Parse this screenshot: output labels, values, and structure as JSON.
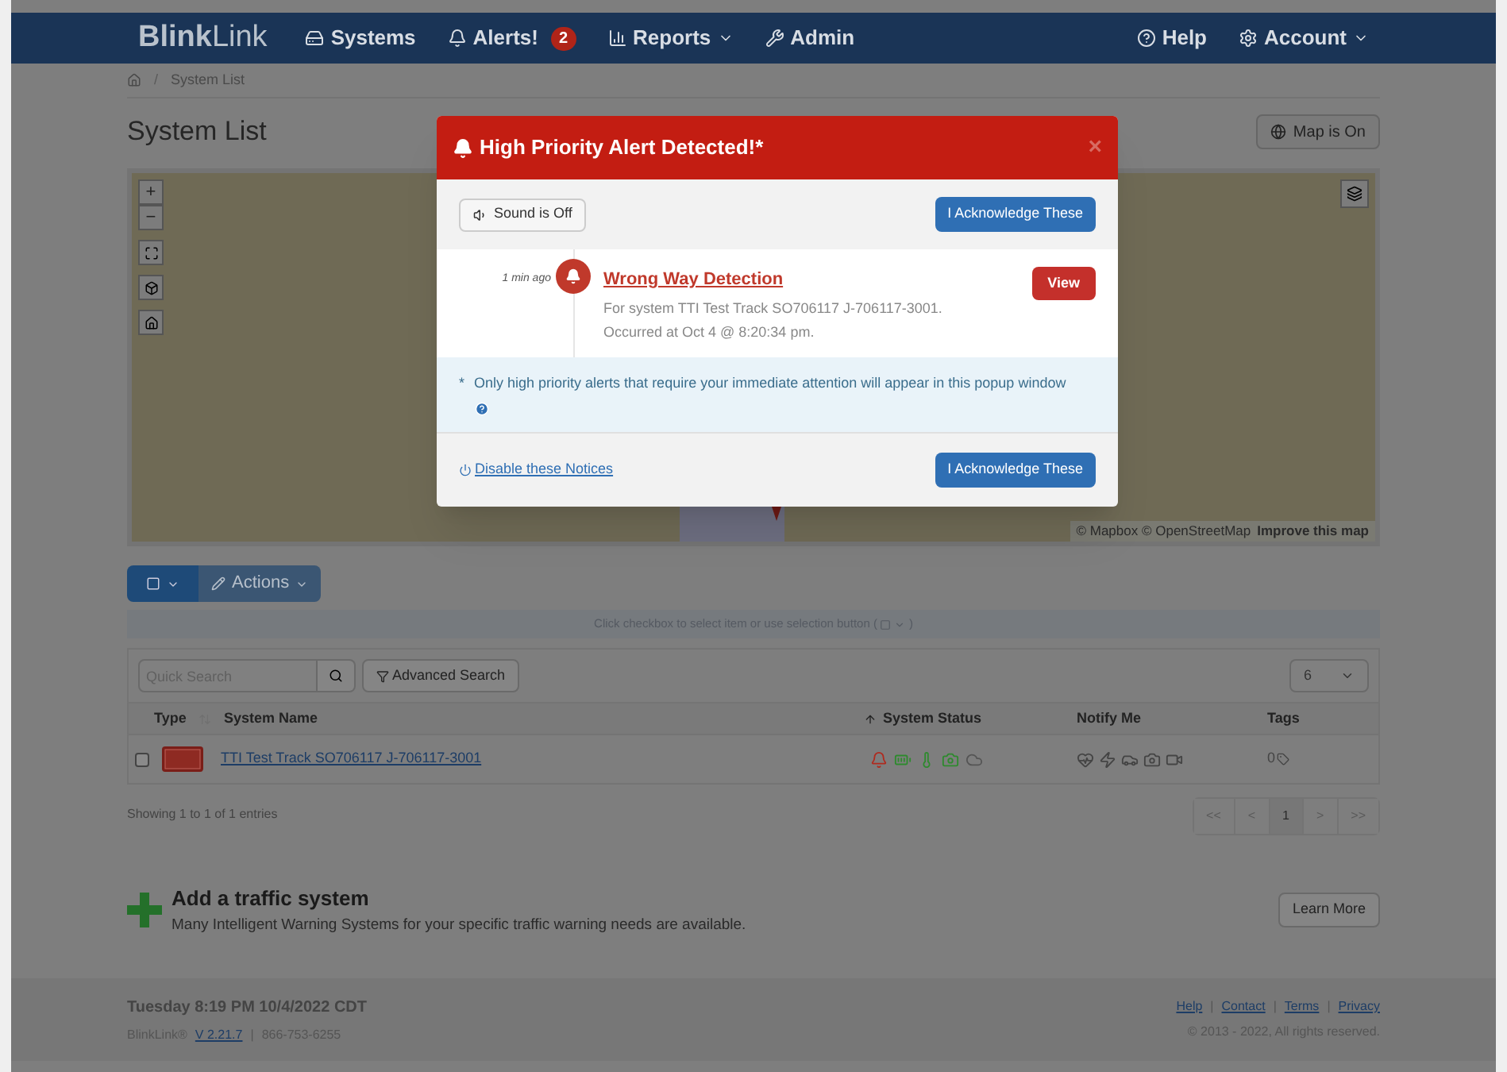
{
  "navbar": {
    "brand": "**Blink**Link",
    "items": [
      {
        "kind": "systems",
        "label": "Systems",
        "dropdown": false
      },
      {
        "kind": "alerts",
        "label": "Alerts!",
        "badge": "2",
        "dropdown": false
      },
      {
        "kind": "reports",
        "label": "Reports",
        "dropdown": true
      },
      {
        "kind": "admin",
        "label": "Admin",
        "dropdown": false
      }
    ],
    "right_items": [
      {
        "kind": "help",
        "label": "Help",
        "dropdown": false
      },
      {
        "kind": "account",
        "label": "Account",
        "dropdown": true
      }
    ]
  },
  "breadcrumb": [
    {
      "separator": "/",
      "label": "System List"
    }
  ],
  "page_title": "System List",
  "map_toggle": "Map is On",
  "map": {
    "zoom_in": "+",
    "zoom_out": "−",
    "attribution": "© Mapbox © OpenStreetMap",
    "improve_link": "Improve this map"
  },
  "toolbar": {
    "actions": "Actions",
    "hint": "Click checkbox to select item or use selection button (",
    "hint_end": ")"
  },
  "search": {
    "placeholder": "Quick Search",
    "advanced": "Advanced Search",
    "page_size": "6"
  },
  "table": {
    "columns": [
      {
        "label": "Type",
        "sortable_hint": false,
        "sorted": false
      },
      {
        "label": "System Name",
        "sortable_hint": true,
        "sorted": false
      },
      {
        "label": "System Status",
        "sortable_hint": false,
        "sorted": true
      },
      {
        "label": "Notify Me",
        "sortable_hint": false,
        "sorted": false
      },
      {
        "label": "Tags",
        "sortable_hint": false,
        "sorted": false
      }
    ],
    "rows": [
      {
        "checked": false,
        "name": "TTI Test Track SO706117 J-706117-3001",
        "status": [
          {
            "kind": "bell",
            "color": "#b02a1e"
          },
          {
            "kind": "battery",
            "color": "#2e8a2e"
          },
          {
            "kind": "thermometer",
            "color": "#2e8a2e"
          },
          {
            "kind": "camera",
            "color": "#2e8a2e"
          },
          {
            "kind": "cloud",
            "color": "#555555"
          }
        ],
        "notify": [
          {
            "kind": "heart"
          },
          {
            "kind": "bolt"
          },
          {
            "kind": "car"
          },
          {
            "kind": "camera"
          },
          {
            "kind": "video"
          }
        ],
        "tags": "0"
      }
    ]
  },
  "showing": "Showing 1 to 1 of 1 entries",
  "pagination": [
    {
      "label": "<<",
      "selected": false
    },
    {
      "label": "<",
      "selected": false
    },
    {
      "label": "1",
      "selected": true
    },
    {
      "label": ">",
      "selected": false
    },
    {
      "label": ">>",
      "selected": false
    }
  ],
  "add_system": {
    "title": "Add a traffic system",
    "description": "Many Intelligent Warning Systems for your specific traffic warning needs are available.",
    "button": "Learn More"
  },
  "footer": {
    "datetime": "Tuesday 8:19 PM 10/4/2022 CDT",
    "product": "BlinkLink®",
    "version": "V 2.21.7",
    "phone_separator": "|",
    "phone": "866-753-6255",
    "links": [
      {
        "label": "Help"
      },
      {
        "separator": "|",
        "label": "Contact"
      },
      {
        "separator": "|",
        "label": "Terms"
      },
      {
        "separator": "|",
        "label": "Privacy"
      }
    ],
    "copyright": "© 2013 - 2022, All rights reserved."
  },
  "modal": {
    "title": "High Priority Alert Detected!*",
    "close": "×",
    "sound": "Sound is Off",
    "acknowledge_top": "I Acknowledge These",
    "alert": {
      "time": "1 min ago",
      "title": "Wrong Way Detection",
      "system_line": "For system TTI Test Track SO706117 J-706117-3001.",
      "occurred_line": "Occurred at Oct 4 @ 8:20:34 pm.",
      "view": "View"
    },
    "note_mark": "*",
    "note": "Only high priority alerts that require your immediate attention will appear in this popup window",
    "disable_link": "Disable these Notices",
    "acknowledge_bottom": "I Acknowledge These"
  }
}
